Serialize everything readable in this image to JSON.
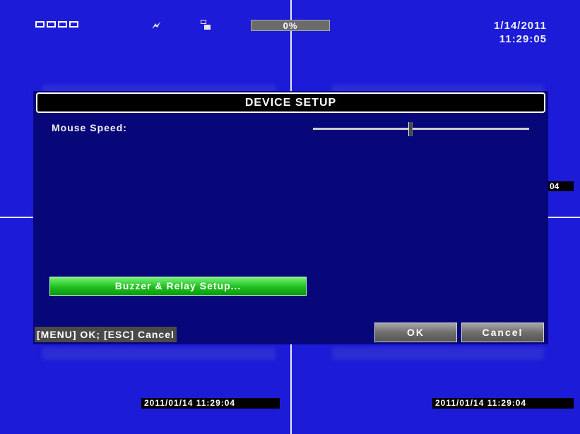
{
  "status": {
    "camera_icons": [
      "camera-1-icon",
      "camera-2-icon",
      "camera-3-icon",
      "camera-4-icon"
    ],
    "progress_percent": 0,
    "progress_label": "0%",
    "date": "1/14/2011",
    "time": "11:29:05"
  },
  "channels": {
    "timestamp_ch3": "2011/01/14 11:29:04",
    "timestamp_ch4": "2011/01/14 11:29:04",
    "timestamp_ch2_partial": "04"
  },
  "dialog": {
    "title": "DEVICE SETUP",
    "mouse_speed_label": "Mouse Speed:",
    "mouse_speed_value": 0.45,
    "buzzer_button": "Buzzer & Relay Setup...",
    "hint": "[MENU] OK; [ESC] Cancel",
    "ok_label": "OK",
    "cancel_label": "Cancel"
  },
  "colors": {
    "background_blue": "#1b1bd8",
    "dialog_bg": "#07077a",
    "green_button": "#1fbf1f"
  }
}
